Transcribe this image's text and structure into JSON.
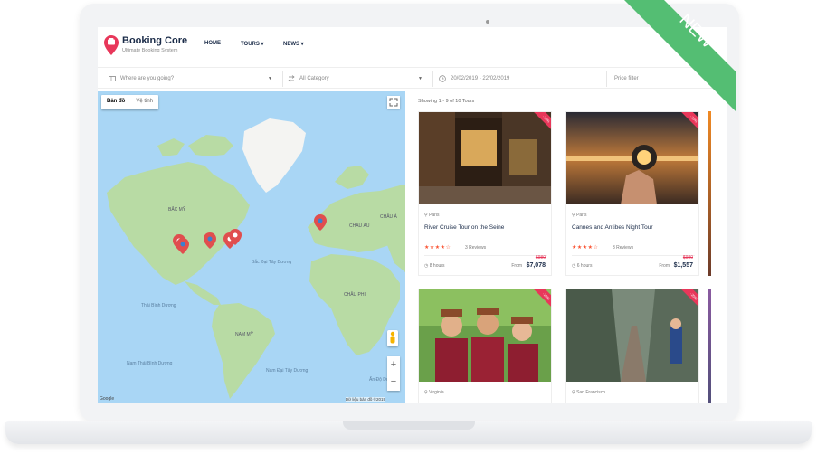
{
  "app": {
    "name": "Booking Core",
    "tagline": "Ultimate Booking System"
  },
  "nav": [
    {
      "label": "HOME"
    },
    {
      "label": "TOURS ▾"
    },
    {
      "label": "NEWS ▾"
    }
  ],
  "search": {
    "location": "Where are you going?",
    "category": "All Category",
    "dates": "20/02/2019 - 22/02/2019",
    "price": "Price filter"
  },
  "map": {
    "type_map": "Bản đồ",
    "type_satellite": "Vệ tinh",
    "google": "Google",
    "attribution": "Dữ liệu bản đồ ©2019",
    "zoom_in": "+",
    "zoom_out": "−",
    "labels": {
      "north_america": "BẮC MỸ",
      "south_america": "NAM MỸ",
      "europe": "CHÂU ÂU",
      "africa": "CHÂU PHI",
      "asia": "CHÂU Á",
      "atlantic": "Bắc Đại Tây Dương",
      "pacific": "Thái Bình Dương",
      "south_pacific": "Nam Thái Bình Dương",
      "south_atlantic": "Nam Đại Tây Dương",
      "indian": "Ấn Độ Dương"
    }
  },
  "results": {
    "showing": "Showing 1 - 9 of 10 Tours",
    "cards": [
      {
        "ribbon": "-20%",
        "location": "Paris",
        "title": "River Cruise Tour on the Seine",
        "reviews": "3 Reviews",
        "duration": "8 hours",
        "old_price": "$980",
        "from_label": "From",
        "price": "$7,078",
        "rating": 4
      },
      {
        "ribbon": "-20%",
        "location": "Paris",
        "title": "Cannes and Antibes Night Tour",
        "reviews": "3 Reviews",
        "duration": "6 hours",
        "old_price": "$980",
        "from_label": "From",
        "price": "$1,557",
        "rating": 4
      },
      {
        "ribbon": "-20%",
        "location": "Virginia",
        "title": "",
        "reviews": "",
        "duration": "",
        "old_price": "",
        "from_label": "",
        "price": "",
        "rating": 0
      },
      {
        "ribbon": "-20%",
        "location": "San Francisco",
        "title": "",
        "reviews": "",
        "duration": "",
        "old_price": "",
        "from_label": "",
        "price": "",
        "rating": 0
      }
    ]
  },
  "badge": {
    "label": "NEW"
  },
  "colors": {
    "brand": "#e8375a",
    "accent": "#fa5636",
    "badge": "#54be73",
    "water": "#a9d6f5",
    "land": "#b8dba4"
  }
}
